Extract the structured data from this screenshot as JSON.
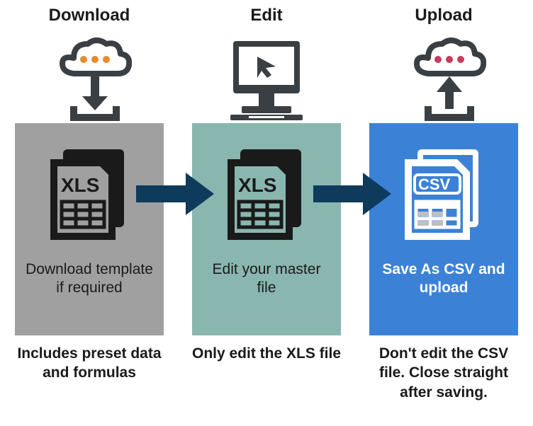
{
  "steps": [
    {
      "title": "Download",
      "card_text": "Download template if required",
      "bottom_text": "Includes preset data and formulas",
      "file_label": "XLS"
    },
    {
      "title": "Edit",
      "card_text": "Edit your master file",
      "bottom_text": "Only edit the XLS file",
      "file_label": "XLS"
    },
    {
      "title": "Upload",
      "card_text": "Save As CSV and upload",
      "bottom_text": "Don't edit the CSV file. Close straight after saving.",
      "file_label": "CSV"
    }
  ],
  "colors": {
    "orange_dots": "#e68a2e",
    "red_dots": "#c73a5a",
    "arrow": "#0e3a5c",
    "icon_dark": "#3a3f44"
  }
}
